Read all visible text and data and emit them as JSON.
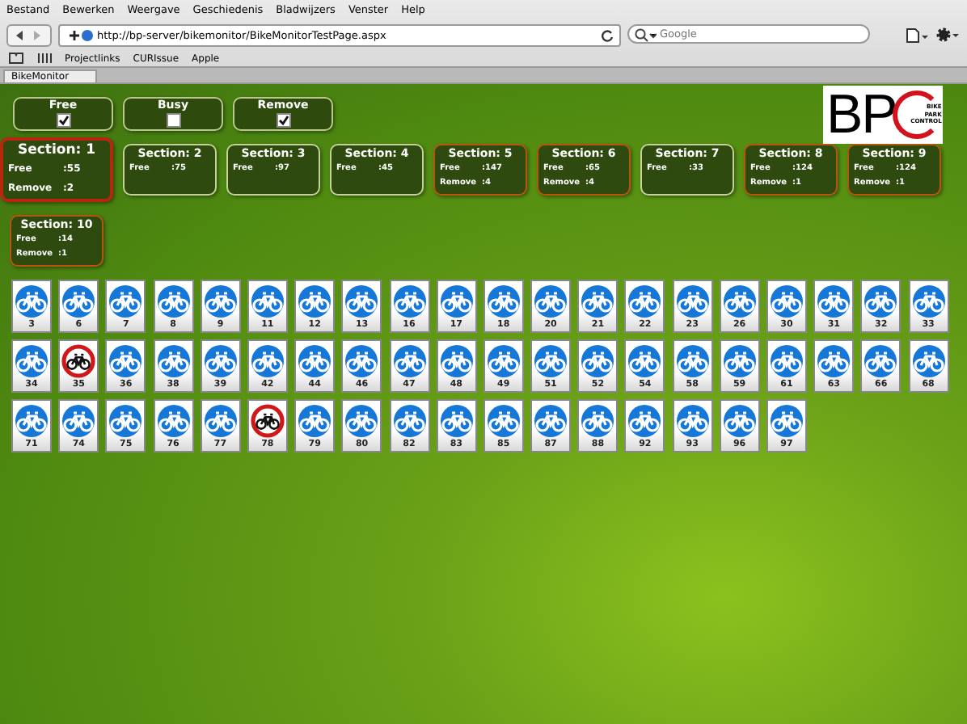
{
  "menu": [
    "Bestand",
    "Bewerken",
    "Weergave",
    "Geschiedenis",
    "Bladwijzers",
    "Venster",
    "Help"
  ],
  "address": "http://bp-server/bikemonitor/BikeMonitorTestPage.aspx",
  "search": {
    "placeholder": "Google"
  },
  "bookmarks": [
    "Projectlinks",
    "CURIssue",
    "Apple"
  ],
  "tab": {
    "title": "BikeMonitor",
    "selected": true
  },
  "logo": {
    "letters": "BP",
    "lines": [
      "BIKE",
      "PARK",
      "CONTROL"
    ]
  },
  "filters": [
    {
      "label": "Free",
      "checked": true
    },
    {
      "label": "Busy",
      "checked": false
    },
    {
      "label": "Remove",
      "checked": true
    }
  ],
  "sections": [
    {
      "title": "Section: 1",
      "selected": true,
      "rows": [
        {
          "label": "Free",
          "value": ":55"
        },
        {
          "label": "Remove",
          "value": ":2"
        }
      ]
    },
    {
      "title": "Section: 2",
      "selected": false,
      "rows": [
        {
          "label": "Free",
          "value": ":75"
        }
      ]
    },
    {
      "title": "Section: 3",
      "selected": false,
      "rows": [
        {
          "label": "Free",
          "value": ":97"
        }
      ]
    },
    {
      "title": "Section: 4",
      "selected": false,
      "rows": [
        {
          "label": "Free",
          "value": ":45"
        }
      ]
    },
    {
      "title": "Section: 5",
      "selected": false,
      "rows": [
        {
          "label": "Free",
          "value": ":147"
        },
        {
          "label": "Remove",
          "value": ":4"
        }
      ]
    },
    {
      "title": "Section: 6",
      "selected": false,
      "rows": [
        {
          "label": "Free",
          "value": ":65"
        },
        {
          "label": "Remove",
          "value": ":4"
        }
      ]
    },
    {
      "title": "Section: 7",
      "selected": false,
      "rows": [
        {
          "label": "Free",
          "value": ":33"
        }
      ]
    },
    {
      "title": "Section: 8",
      "selected": false,
      "rows": [
        {
          "label": "Free",
          "value": ":124"
        },
        {
          "label": "Remove",
          "value": ":1"
        }
      ]
    },
    {
      "title": "Section: 9",
      "selected": false,
      "rows": [
        {
          "label": "Free",
          "value": ":124"
        },
        {
          "label": "Remove",
          "value": ":1"
        }
      ]
    },
    {
      "title": "Section: 10",
      "selected": false,
      "rows": [
        {
          "label": "Free",
          "value": ":14"
        },
        {
          "label": "Remove",
          "value": ":1"
        }
      ]
    }
  ],
  "slots": [
    {
      "number": "3",
      "kind": "free"
    },
    {
      "number": "6",
      "kind": "free"
    },
    {
      "number": "7",
      "kind": "free"
    },
    {
      "number": "8",
      "kind": "free"
    },
    {
      "number": "9",
      "kind": "free"
    },
    {
      "number": "11",
      "kind": "free"
    },
    {
      "number": "12",
      "kind": "free"
    },
    {
      "number": "13",
      "kind": "free"
    },
    {
      "number": "16",
      "kind": "free"
    },
    {
      "number": "17",
      "kind": "free"
    },
    {
      "number": "18",
      "kind": "free"
    },
    {
      "number": "20",
      "kind": "free"
    },
    {
      "number": "21",
      "kind": "free"
    },
    {
      "number": "22",
      "kind": "free"
    },
    {
      "number": "23",
      "kind": "free"
    },
    {
      "number": "26",
      "kind": "free"
    },
    {
      "number": "30",
      "kind": "free"
    },
    {
      "number": "31",
      "kind": "free"
    },
    {
      "number": "32",
      "kind": "free"
    },
    {
      "number": "33",
      "kind": "free"
    },
    {
      "number": "34",
      "kind": "free"
    },
    {
      "number": "35",
      "kind": "remove"
    },
    {
      "number": "36",
      "kind": "free"
    },
    {
      "number": "38",
      "kind": "free"
    },
    {
      "number": "39",
      "kind": "free"
    },
    {
      "number": "42",
      "kind": "free"
    },
    {
      "number": "44",
      "kind": "free"
    },
    {
      "number": "46",
      "kind": "free"
    },
    {
      "number": "47",
      "kind": "free"
    },
    {
      "number": "48",
      "kind": "free"
    },
    {
      "number": "49",
      "kind": "free"
    },
    {
      "number": "51",
      "kind": "free"
    },
    {
      "number": "52",
      "kind": "free"
    },
    {
      "number": "54",
      "kind": "free"
    },
    {
      "number": "58",
      "kind": "free"
    },
    {
      "number": "59",
      "kind": "free"
    },
    {
      "number": "61",
      "kind": "free"
    },
    {
      "number": "63",
      "kind": "free"
    },
    {
      "number": "66",
      "kind": "free"
    },
    {
      "number": "68",
      "kind": "free"
    },
    {
      "number": "71",
      "kind": "free"
    },
    {
      "number": "74",
      "kind": "free"
    },
    {
      "number": "75",
      "kind": "free"
    },
    {
      "number": "76",
      "kind": "free"
    },
    {
      "number": "77",
      "kind": "free"
    },
    {
      "number": "78",
      "kind": "remove"
    },
    {
      "number": "79",
      "kind": "free"
    },
    {
      "number": "80",
      "kind": "free"
    },
    {
      "number": "82",
      "kind": "free"
    },
    {
      "number": "83",
      "kind": "free"
    },
    {
      "number": "85",
      "kind": "free"
    },
    {
      "number": "87",
      "kind": "free"
    },
    {
      "number": "88",
      "kind": "free"
    },
    {
      "number": "92",
      "kind": "free"
    },
    {
      "number": "93",
      "kind": "free"
    },
    {
      "number": "96",
      "kind": "free"
    },
    {
      "number": "97",
      "kind": "free"
    }
  ]
}
